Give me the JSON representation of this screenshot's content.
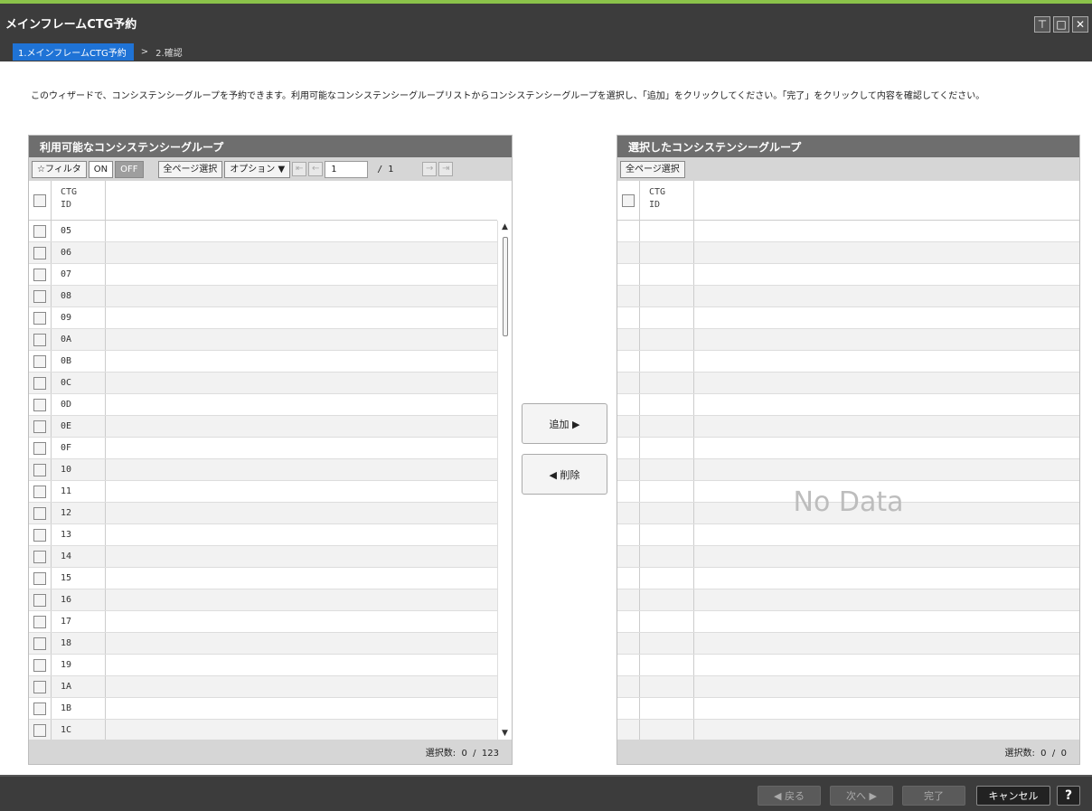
{
  "window": {
    "title": "メインフレームCTG予約",
    "controls": [
      "pin-icon",
      "maximize-icon",
      "close-icon"
    ]
  },
  "breadcrumb": {
    "step1": "1.メインフレームCTG予約",
    "separator": ">",
    "step2": "2.確認"
  },
  "instruction": "このウィザードで、コンシステンシーグループを予約できます。利用可能なコンシステンシーグループリストからコンシステンシーグループを選択し、「追加」をクリックしてください。「完了」をクリックして内容を確認してください。",
  "available": {
    "title": "利用可能なコンシステンシーグループ",
    "toolbar": {
      "filter": "☆フィルタ",
      "on": "ON",
      "off": "OFF",
      "select_all": "全ページ選択",
      "options": "オプション ▼",
      "page": "1",
      "page_total": "/ 1"
    },
    "column_header": "CTG\nID",
    "rows": [
      "05",
      "06",
      "07",
      "08",
      "09",
      "0A",
      "0B",
      "0C",
      "0D",
      "0E",
      "0F",
      "10",
      "11",
      "12",
      "13",
      "14",
      "15",
      "16",
      "17",
      "18",
      "19",
      "1A",
      "1B",
      "1C"
    ],
    "footer": "選択数:  0  /  123"
  },
  "selected": {
    "title": "選択したコンシステンシーグループ",
    "select_all": "全ページ選択",
    "column_header": "CTG\nID",
    "no_data": "No Data",
    "footer": "選択数:  0  /  0"
  },
  "buttons": {
    "add": "追加 ▶",
    "remove": "◀ 削除"
  },
  "bottom": {
    "back": "◀ 戻る",
    "next": "次へ ▶",
    "finish": "完了",
    "cancel": "キャンセル",
    "help": "?"
  }
}
